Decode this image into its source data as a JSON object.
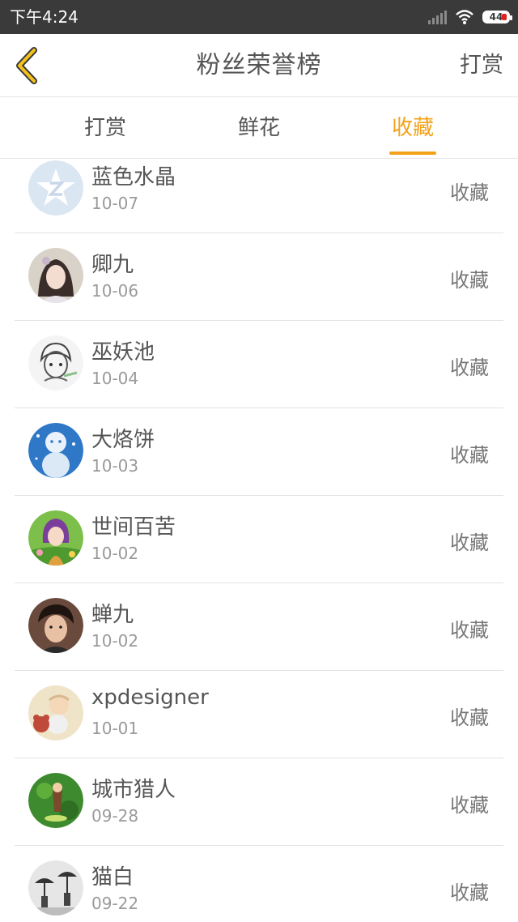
{
  "status_bar": {
    "time": "下午4:24",
    "battery": "44"
  },
  "header": {
    "title": "粉丝荣誉榜",
    "action_label": "打赏"
  },
  "tabs": [
    {
      "label": "打赏",
      "active": false
    },
    {
      "label": "鲜花",
      "active": false
    },
    {
      "label": "收藏",
      "active": true
    }
  ],
  "colors": {
    "accent": "#f3a21a",
    "text": "#555555",
    "subtext": "#9a9a9a"
  },
  "fans": [
    {
      "name": "蓝色水晶",
      "date": "10-07",
      "tag": "收藏",
      "avatar": "qq-star-avatar"
    },
    {
      "name": "卿九",
      "date": "10-06",
      "tag": "收藏",
      "avatar": "girl-portrait-avatar"
    },
    {
      "name": "巫妖池",
      "date": "10-04",
      "tag": "收藏",
      "avatar": "sketch-boy-avatar"
    },
    {
      "name": "大烙饼",
      "date": "10-03",
      "tag": "收藏",
      "avatar": "blue-snowman-avatar"
    },
    {
      "name": "世间百苦",
      "date": "10-02",
      "tag": "收藏",
      "avatar": "anime-girl-avatar"
    },
    {
      "name": "蝉九",
      "date": "10-02",
      "tag": "收藏",
      "avatar": "man-portrait-avatar"
    },
    {
      "name": "xpdesigner",
      "date": "10-01",
      "tag": "收藏",
      "avatar": "baby-bear-avatar"
    },
    {
      "name": "城市猎人",
      "date": "09-28",
      "tag": "收藏",
      "avatar": "game-character-avatar"
    },
    {
      "name": "猫白",
      "date": "09-22",
      "tag": "收藏",
      "avatar": "umbrella-people-avatar"
    }
  ]
}
